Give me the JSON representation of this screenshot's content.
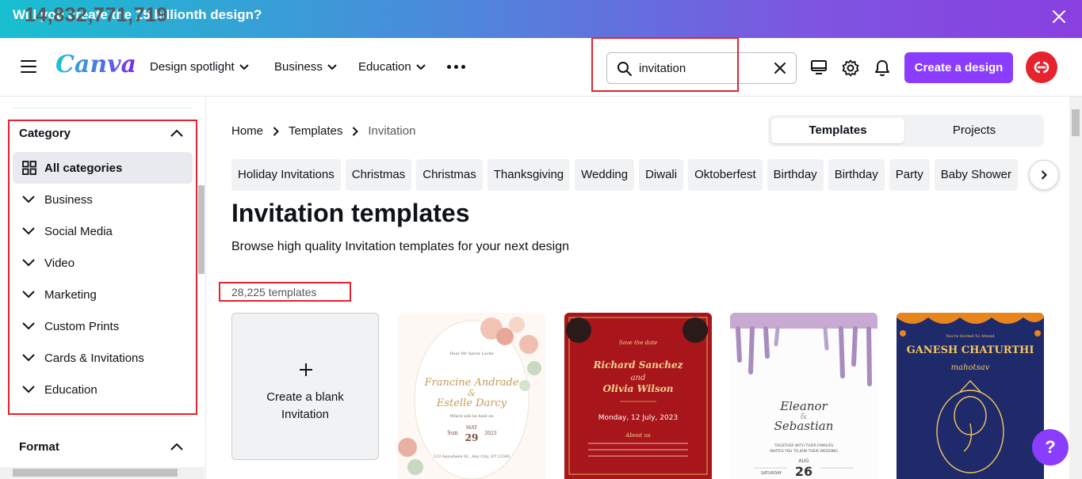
{
  "banner": {
    "message": "Will you create the 15 billionth design?",
    "counter": "14,832,771,719"
  },
  "nav": {
    "logo": "Canva",
    "links": [
      "Design spotlight",
      "Business",
      "Education"
    ],
    "search_value": "invitation",
    "create_label": "Create a design"
  },
  "sidebar": {
    "category_title": "Category",
    "items": [
      "All categories",
      "Business",
      "Social Media",
      "Video",
      "Marketing",
      "Custom Prints",
      "Cards & Invitations",
      "Education"
    ],
    "format_title": "Format"
  },
  "main": {
    "breadcrumb": [
      "Home",
      "Templates",
      "Invitation"
    ],
    "toggle": [
      "Templates",
      "Projects"
    ],
    "chips": [
      "Holiday Invitations",
      "Christmas",
      "Christmas",
      "Thanksgiving",
      "Wedding",
      "Diwali",
      "Oktoberfest",
      "Birthday",
      "Birthday",
      "Party",
      "Baby Shower"
    ],
    "heading": "Invitation templates",
    "subheading": "Browse high quality Invitation templates for your next design",
    "count": "28,225 templates",
    "blank_card": "Create a blank Invitation"
  },
  "templates": {
    "t1": {
      "line1": "Dear Mr Aaron Locke",
      "name1": "Francine Andrade",
      "amp": "&",
      "name2": "Estelle Darcy",
      "lunch": "Which will be held on",
      "day": "Sun",
      "month": "MAY",
      "date": "29",
      "year": "2023",
      "address": "123 Anywhere St., Any City, ST 12345"
    },
    "t2": {
      "save": "Save the date",
      "name1": "Richard Sanchez",
      "and": "and",
      "name2": "Olivia Wilson",
      "date": "Monday, 12 July, 2023",
      "about": "About us"
    },
    "t3": {
      "name1": "Eleanor",
      "amp": "&",
      "name2": "Sebastian",
      "invite": "TOGETHER WITH THEIR FAMILIES",
      "invite2": "INVITES YOU TO JOIN THEIR WEDDING",
      "month": "AUG",
      "date": "26",
      "day": "SATURDAY"
    },
    "t4": {
      "pre": "You're Invited To Attend",
      "title": "GANESH CHATURTHI",
      "script": "mahotsav"
    }
  },
  "colors": {
    "accent": "#8b3dff",
    "red_highlight": "#e5232e",
    "wedding_red": "#a8151b",
    "ganesh_blue": "#1f2a6b"
  },
  "help_label": "?"
}
